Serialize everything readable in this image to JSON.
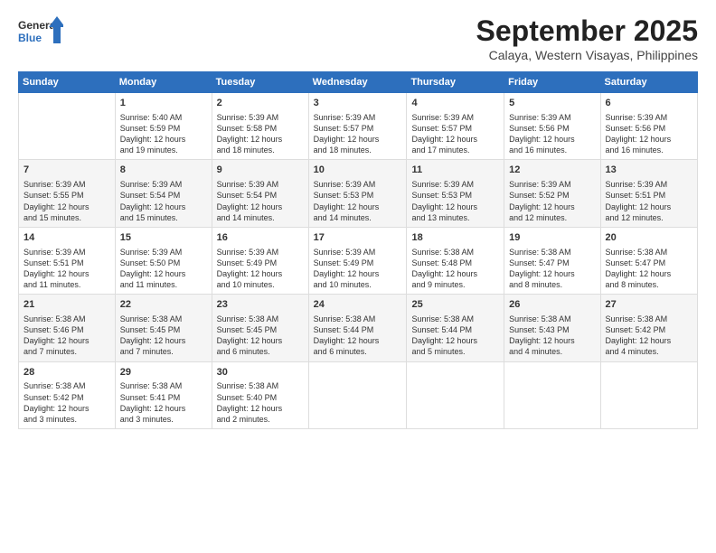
{
  "logo": {
    "line1": "General",
    "line2": "Blue"
  },
  "title": "September 2025",
  "subtitle": "Calaya, Western Visayas, Philippines",
  "days": [
    "Sunday",
    "Monday",
    "Tuesday",
    "Wednesday",
    "Thursday",
    "Friday",
    "Saturday"
  ],
  "weeks": [
    [
      {
        "day": "",
        "info": ""
      },
      {
        "day": "1",
        "info": "Sunrise: 5:40 AM\nSunset: 5:59 PM\nDaylight: 12 hours\nand 19 minutes."
      },
      {
        "day": "2",
        "info": "Sunrise: 5:39 AM\nSunset: 5:58 PM\nDaylight: 12 hours\nand 18 minutes."
      },
      {
        "day": "3",
        "info": "Sunrise: 5:39 AM\nSunset: 5:57 PM\nDaylight: 12 hours\nand 18 minutes."
      },
      {
        "day": "4",
        "info": "Sunrise: 5:39 AM\nSunset: 5:57 PM\nDaylight: 12 hours\nand 17 minutes."
      },
      {
        "day": "5",
        "info": "Sunrise: 5:39 AM\nSunset: 5:56 PM\nDaylight: 12 hours\nand 16 minutes."
      },
      {
        "day": "6",
        "info": "Sunrise: 5:39 AM\nSunset: 5:56 PM\nDaylight: 12 hours\nand 16 minutes."
      }
    ],
    [
      {
        "day": "7",
        "info": "Sunrise: 5:39 AM\nSunset: 5:55 PM\nDaylight: 12 hours\nand 15 minutes."
      },
      {
        "day": "8",
        "info": "Sunrise: 5:39 AM\nSunset: 5:54 PM\nDaylight: 12 hours\nand 15 minutes."
      },
      {
        "day": "9",
        "info": "Sunrise: 5:39 AM\nSunset: 5:54 PM\nDaylight: 12 hours\nand 14 minutes."
      },
      {
        "day": "10",
        "info": "Sunrise: 5:39 AM\nSunset: 5:53 PM\nDaylight: 12 hours\nand 14 minutes."
      },
      {
        "day": "11",
        "info": "Sunrise: 5:39 AM\nSunset: 5:53 PM\nDaylight: 12 hours\nand 13 minutes."
      },
      {
        "day": "12",
        "info": "Sunrise: 5:39 AM\nSunset: 5:52 PM\nDaylight: 12 hours\nand 12 minutes."
      },
      {
        "day": "13",
        "info": "Sunrise: 5:39 AM\nSunset: 5:51 PM\nDaylight: 12 hours\nand 12 minutes."
      }
    ],
    [
      {
        "day": "14",
        "info": "Sunrise: 5:39 AM\nSunset: 5:51 PM\nDaylight: 12 hours\nand 11 minutes."
      },
      {
        "day": "15",
        "info": "Sunrise: 5:39 AM\nSunset: 5:50 PM\nDaylight: 12 hours\nand 11 minutes."
      },
      {
        "day": "16",
        "info": "Sunrise: 5:39 AM\nSunset: 5:49 PM\nDaylight: 12 hours\nand 10 minutes."
      },
      {
        "day": "17",
        "info": "Sunrise: 5:39 AM\nSunset: 5:49 PM\nDaylight: 12 hours\nand 10 minutes."
      },
      {
        "day": "18",
        "info": "Sunrise: 5:38 AM\nSunset: 5:48 PM\nDaylight: 12 hours\nand 9 minutes."
      },
      {
        "day": "19",
        "info": "Sunrise: 5:38 AM\nSunset: 5:47 PM\nDaylight: 12 hours\nand 8 minutes."
      },
      {
        "day": "20",
        "info": "Sunrise: 5:38 AM\nSunset: 5:47 PM\nDaylight: 12 hours\nand 8 minutes."
      }
    ],
    [
      {
        "day": "21",
        "info": "Sunrise: 5:38 AM\nSunset: 5:46 PM\nDaylight: 12 hours\nand 7 minutes."
      },
      {
        "day": "22",
        "info": "Sunrise: 5:38 AM\nSunset: 5:45 PM\nDaylight: 12 hours\nand 7 minutes."
      },
      {
        "day": "23",
        "info": "Sunrise: 5:38 AM\nSunset: 5:45 PM\nDaylight: 12 hours\nand 6 minutes."
      },
      {
        "day": "24",
        "info": "Sunrise: 5:38 AM\nSunset: 5:44 PM\nDaylight: 12 hours\nand 6 minutes."
      },
      {
        "day": "25",
        "info": "Sunrise: 5:38 AM\nSunset: 5:44 PM\nDaylight: 12 hours\nand 5 minutes."
      },
      {
        "day": "26",
        "info": "Sunrise: 5:38 AM\nSunset: 5:43 PM\nDaylight: 12 hours\nand 4 minutes."
      },
      {
        "day": "27",
        "info": "Sunrise: 5:38 AM\nSunset: 5:42 PM\nDaylight: 12 hours\nand 4 minutes."
      }
    ],
    [
      {
        "day": "28",
        "info": "Sunrise: 5:38 AM\nSunset: 5:42 PM\nDaylight: 12 hours\nand 3 minutes."
      },
      {
        "day": "29",
        "info": "Sunrise: 5:38 AM\nSunset: 5:41 PM\nDaylight: 12 hours\nand 3 minutes."
      },
      {
        "day": "30",
        "info": "Sunrise: 5:38 AM\nSunset: 5:40 PM\nDaylight: 12 hours\nand 2 minutes."
      },
      {
        "day": "",
        "info": ""
      },
      {
        "day": "",
        "info": ""
      },
      {
        "day": "",
        "info": ""
      },
      {
        "day": "",
        "info": ""
      }
    ]
  ]
}
